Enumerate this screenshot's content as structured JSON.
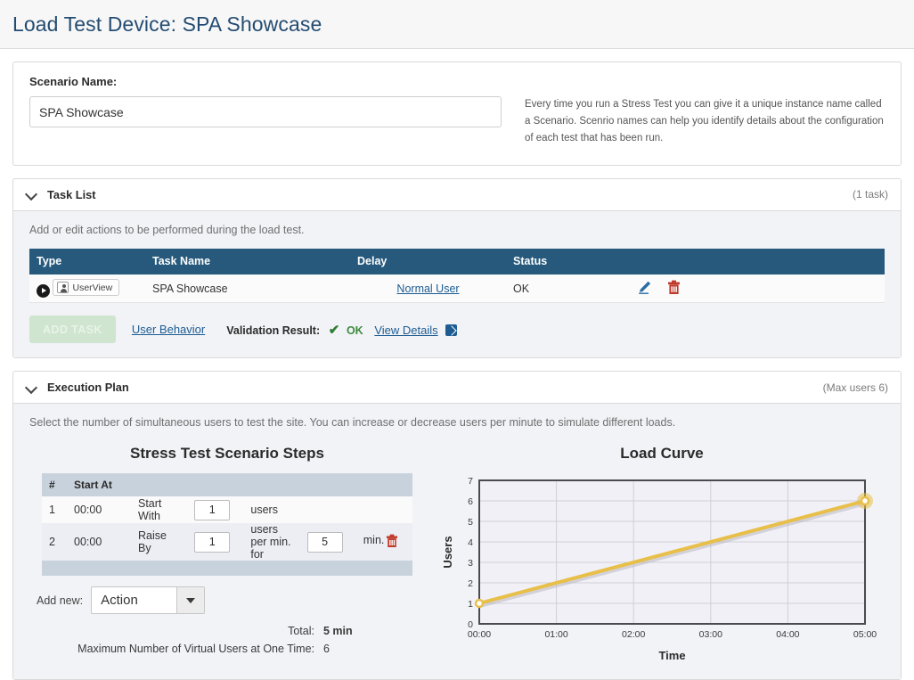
{
  "header": {
    "title": "Load Test Device: SPA Showcase"
  },
  "scenario": {
    "label": "Scenario Name:",
    "value": "SPA Showcase",
    "placeholder": "Scenario Name",
    "help": "Every time you run a Stress Test you can give it a unique instance name called a Scenario. Scenrio names can help you identify details about the configuration of each test that has been run."
  },
  "task_list": {
    "title": "Task List",
    "count_label": "(1 task)",
    "description": "Add or edit actions to be performed during the load test.",
    "columns": [
      "Type",
      "Task Name",
      "Delay",
      "Status",
      ""
    ],
    "rows": [
      {
        "type_badge": "UserView",
        "name": "SPA Showcase",
        "delay": "Normal User",
        "status": "OK"
      }
    ],
    "add_task_label": "ADD TASK",
    "user_behavior_label": "User Behavior",
    "validation_label": "Validation Result:",
    "validation_check": "✔",
    "validation_value": "OK",
    "view_details_label": "View Details"
  },
  "execution_plan": {
    "title": "Execution Plan",
    "max_users_label": "(Max users 6)",
    "description": "Select the number of simultaneous users to test the site. You can increase or decrease users per minute to simulate different loads.",
    "steps_title": "Stress Test Scenario Steps",
    "steps_columns": [
      "#",
      "Start At"
    ],
    "steps": [
      {
        "num": "1",
        "start_at": "00:00",
        "action": "Start With",
        "value1": "1",
        "unit1": "users",
        "value2": "",
        "unit2": "",
        "deletable": false
      },
      {
        "num": "2",
        "start_at": "00:00",
        "action": "Raise By",
        "value1": "1",
        "unit1": "users per min. for",
        "value2": "5",
        "unit2": "min.",
        "deletable": true
      }
    ],
    "add_new_label": "Add new:",
    "add_new_value": "Action",
    "total_label": "Total:",
    "total_value": "5 min",
    "max_virtual_label": "Maximum Number of Virtual Users at One Time:",
    "max_virtual_value": "6"
  },
  "chart_data": {
    "type": "line",
    "title": "Load Curve",
    "xlabel": "Time",
    "ylabel": "Users",
    "x_ticks": [
      "00:00",
      "01:00",
      "02:00",
      "03:00",
      "04:00",
      "05:00"
    ],
    "y_ticks": [
      "0",
      "1",
      "2",
      "3",
      "4",
      "5",
      "6",
      "7"
    ],
    "xlim": [
      0,
      5
    ],
    "ylim": [
      0,
      7
    ],
    "grid": true,
    "legend": "none",
    "line_color": "#e8bf48",
    "series": [
      {
        "name": "Users",
        "x": [
          0,
          5
        ],
        "values": [
          1,
          6
        ],
        "markers": [
          {
            "x": 0,
            "y": 1,
            "highlighted": false
          },
          {
            "x": 5,
            "y": 6,
            "highlighted": true
          }
        ]
      }
    ]
  },
  "colors": {
    "title": "#244c72",
    "table_header": "#26597c",
    "link": "#1d5c92",
    "ok_green": "#3d8b3d",
    "accent_yellow": "#e8bf48",
    "panel_bg": "#f2f3f7"
  }
}
